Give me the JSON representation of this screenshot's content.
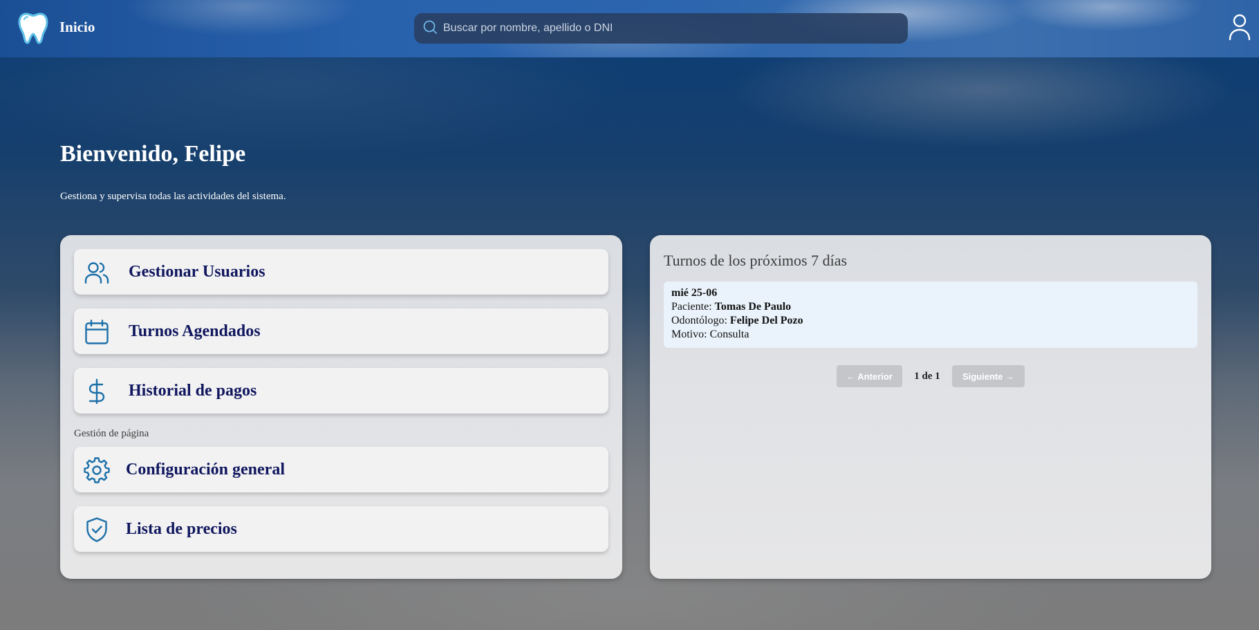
{
  "header": {
    "brand_title": "Inicio",
    "brand_icon": "tooth-icon",
    "search": {
      "placeholder": "Buscar por nombre, apellido o DNI",
      "value": ""
    },
    "user_icon": "user-icon"
  },
  "hero": {
    "welcome": "Bienvenido, Felipe",
    "subtitle": "Gestiona y supervisa todas las actividades del sistema."
  },
  "menu": {
    "items": [
      {
        "label": "Gestionar Usuarios",
        "icon": "users-icon"
      },
      {
        "label": "Turnos Agendados",
        "icon": "calendar-icon"
      },
      {
        "label": "Historial de pagos",
        "icon": "dollar-icon"
      }
    ],
    "section_label": "Gestión de página",
    "page_items": [
      {
        "label": "Configuración general",
        "icon": "gear-icon"
      },
      {
        "label": "Lista de precios",
        "icon": "shield-check-icon"
      }
    ]
  },
  "appointments": {
    "title": "Turnos de los próximos 7 días",
    "items": [
      {
        "date": "mié 25-06",
        "patient_label": "Paciente:",
        "patient": "Tomas De Paulo",
        "dentist_label": "Odontólogo:",
        "dentist": "Felipe Del Pozo",
        "reason_label": "Motivo:",
        "reason": "Consulta"
      }
    ],
    "pager": {
      "prev_label": "← Anterior",
      "page_info": "1 de 1",
      "next_label": "Siguiente →"
    }
  },
  "colors": {
    "accent_icon": "#1c6fa8",
    "menu_text": "#10175e",
    "appt_card_bg": "#eaf3fb",
    "pager_button": "#c4c6ca"
  }
}
